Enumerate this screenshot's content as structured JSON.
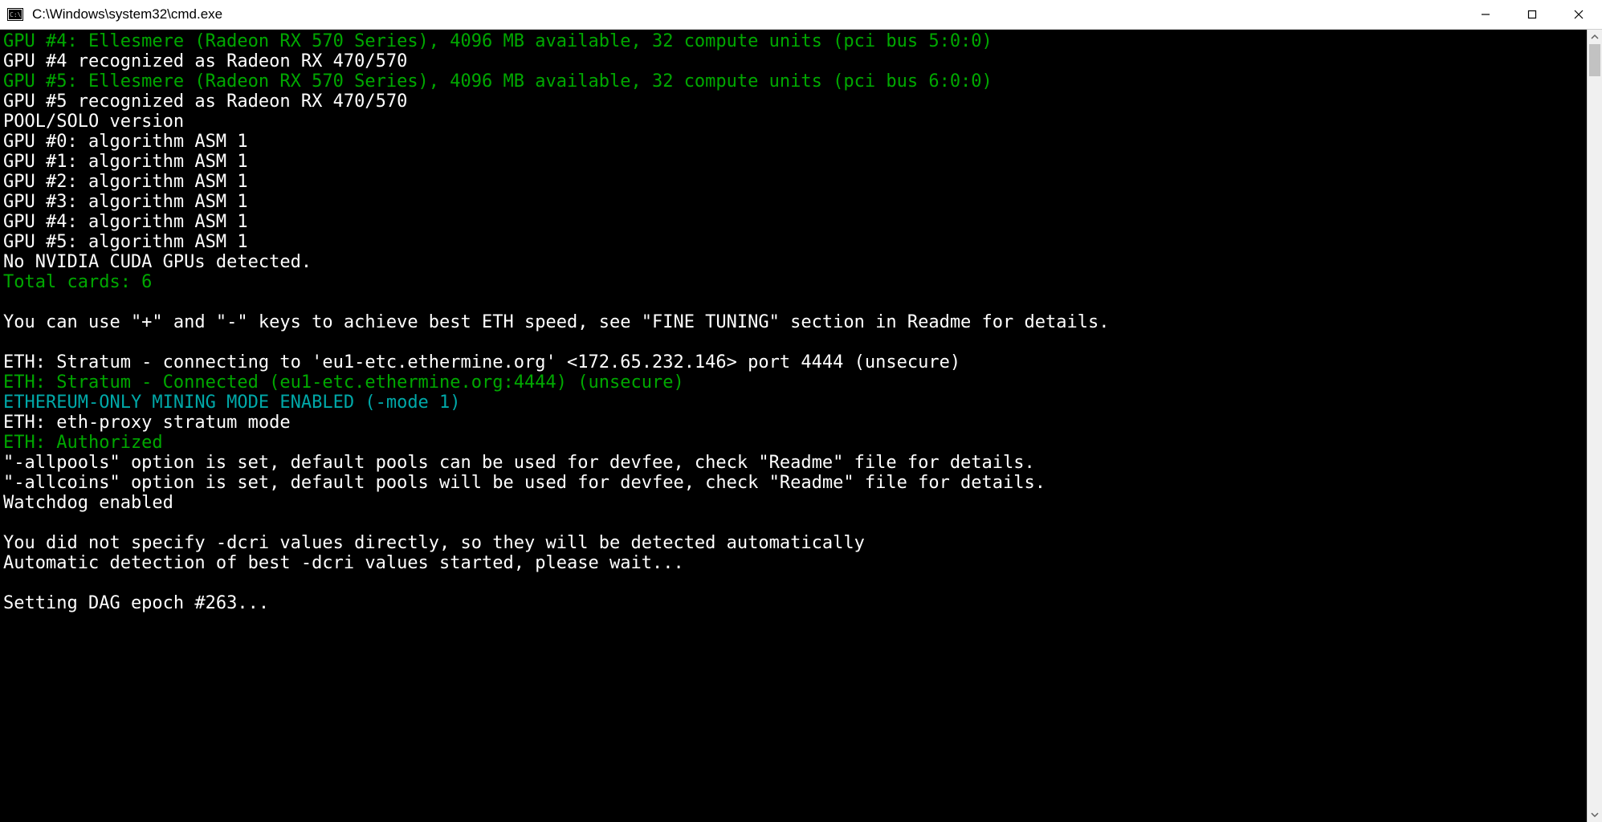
{
  "window": {
    "title": "C:\\Windows\\system32\\cmd.exe"
  },
  "terminal": {
    "lines": [
      {
        "color": "green",
        "text": "GPU #4: Ellesmere (Radeon RX 570 Series), 4096 MB available, 32 compute units (pci bus 5:0:0)"
      },
      {
        "color": "white",
        "text": "GPU #4 recognized as Radeon RX 470/570"
      },
      {
        "color": "green",
        "text": "GPU #5: Ellesmere (Radeon RX 570 Series), 4096 MB available, 32 compute units (pci bus 6:0:0)"
      },
      {
        "color": "white",
        "text": "GPU #5 recognized as Radeon RX 470/570"
      },
      {
        "color": "white",
        "text": "POOL/SOLO version"
      },
      {
        "color": "white",
        "text": "GPU #0: algorithm ASM 1"
      },
      {
        "color": "white",
        "text": "GPU #1: algorithm ASM 1"
      },
      {
        "color": "white",
        "text": "GPU #2: algorithm ASM 1"
      },
      {
        "color": "white",
        "text": "GPU #3: algorithm ASM 1"
      },
      {
        "color": "white",
        "text": "GPU #4: algorithm ASM 1"
      },
      {
        "color": "white",
        "text": "GPU #5: algorithm ASM 1"
      },
      {
        "color": "white",
        "text": "No NVIDIA CUDA GPUs detected."
      },
      {
        "color": "green",
        "text": "Total cards: 6"
      },
      {
        "color": "white",
        "text": ""
      },
      {
        "color": "white",
        "text": "You can use \"+\" and \"-\" keys to achieve best ETH speed, see \"FINE TUNING\" section in Readme for details."
      },
      {
        "color": "white",
        "text": ""
      },
      {
        "color": "white",
        "text": "ETH: Stratum - connecting to 'eu1-etc.ethermine.org' <172.65.232.146> port 4444 (unsecure)"
      },
      {
        "color": "green",
        "text": "ETH: Stratum - Connected (eu1-etc.ethermine.org:4444) (unsecure)"
      },
      {
        "color": "cyan",
        "text": "ETHEREUM-ONLY MINING MODE ENABLED (-mode 1)"
      },
      {
        "color": "white",
        "text": "ETH: eth-proxy stratum mode"
      },
      {
        "color": "green",
        "text": "ETH: Authorized"
      },
      {
        "color": "white",
        "text": "\"-allpools\" option is set, default pools can be used for devfee, check \"Readme\" file for details."
      },
      {
        "color": "white",
        "text": "\"-allcoins\" option is set, default pools will be used for devfee, check \"Readme\" file for details."
      },
      {
        "color": "white",
        "text": "Watchdog enabled"
      },
      {
        "color": "white",
        "text": ""
      },
      {
        "color": "white",
        "text": "You did not specify -dcri values directly, so they will be detected automatically"
      },
      {
        "color": "white",
        "text": "Automatic detection of best -dcri values started, please wait..."
      },
      {
        "color": "white",
        "text": ""
      },
      {
        "color": "white",
        "text": "Setting DAG epoch #263..."
      }
    ]
  }
}
